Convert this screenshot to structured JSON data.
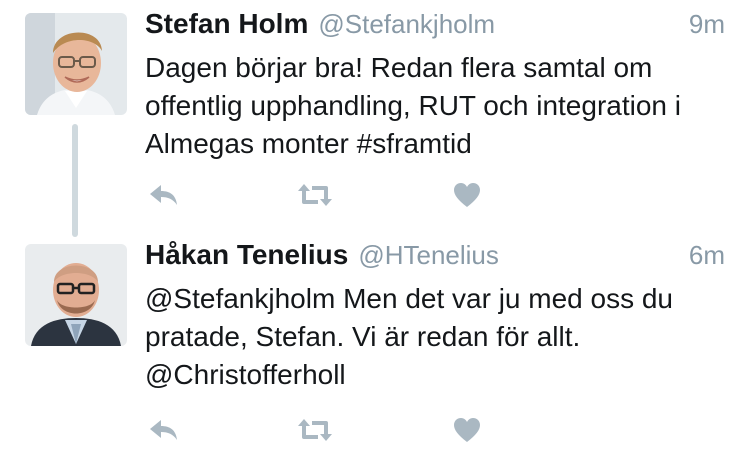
{
  "colors": {
    "text": "#14171a",
    "secondary": "#8899a6",
    "icon": "#aab8c2",
    "thread_line": "#cfd9de"
  },
  "tweets": [
    {
      "name": "Stefan Holm",
      "handle": "@Stefankjholm",
      "time": "9m",
      "text": "Dagen börjar bra! Redan flera samtal om offentlig upphandling, RUT och integration i Almegas monter #sframtid",
      "avatar_icon": "profile-photo-stefan-holm",
      "actions": [
        "reply-icon",
        "retweet-icon",
        "like-icon"
      ]
    },
    {
      "name": "Håkan Tenelius",
      "handle": "@HTenelius",
      "time": "6m",
      "text": "@Stefankjholm Men det var ju med oss du pratade, Stefan. Vi är redan för allt. @Christofferholl",
      "avatar_icon": "profile-photo-hakan-tenelius",
      "actions": [
        "reply-icon",
        "retweet-icon",
        "like-icon"
      ]
    }
  ]
}
